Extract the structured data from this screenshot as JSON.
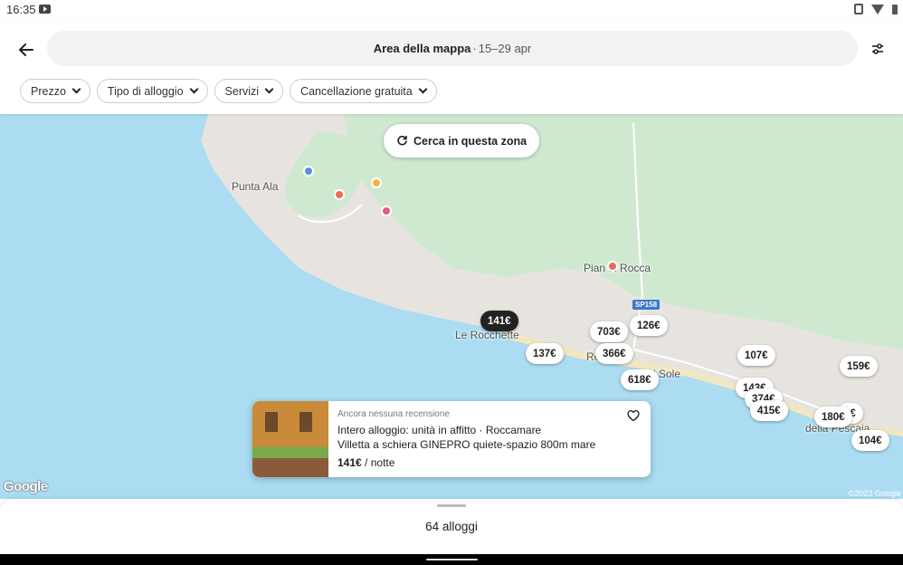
{
  "status_bar": {
    "time": "16:35"
  },
  "header": {
    "search_title": "Area della mappa",
    "search_sep": "·",
    "search_dates": "15–29 apr"
  },
  "filters": [
    {
      "label": "Prezzo"
    },
    {
      "label": "Tipo di alloggio"
    },
    {
      "label": "Servizi"
    },
    {
      "label": "Cancellazione gratuita"
    }
  ],
  "map": {
    "search_area_label": "Cerca in questa zona",
    "places": {
      "punta_ala": "Punta Ala",
      "pian_di_rocca": "Pian di Rocca",
      "le_rocchette": "Le Rocchette",
      "rocca": "Ro",
      "sole": "l Sole",
      "pescaia": "della Pescaia",
      "road_label": "SP158",
      "google": "Google",
      "copyright": "©2022 Google"
    },
    "price_pins": [
      {
        "label": "141€",
        "selected": true
      },
      {
        "label": "703€"
      },
      {
        "label": "126€"
      },
      {
        "label": "137€"
      },
      {
        "label": "366€"
      },
      {
        "label": "618€"
      },
      {
        "label": "107€"
      },
      {
        "label": "159€"
      },
      {
        "label": "143€"
      },
      {
        "label": "374€"
      },
      {
        "label": "415€"
      },
      {
        "label": "1€"
      },
      {
        "label": "180€"
      },
      {
        "label": "104€"
      }
    ]
  },
  "listing": {
    "reviews": "Ancora nessuna recensione",
    "type_line": "Intero alloggio: unità in affitto · Roccamare",
    "title": "Villetta a schiera GINEPRO quiete-spazio 800m mare",
    "price": "141€",
    "price_suffix": "/ notte"
  },
  "bottom_sheet": {
    "count": "64 alloggi"
  }
}
